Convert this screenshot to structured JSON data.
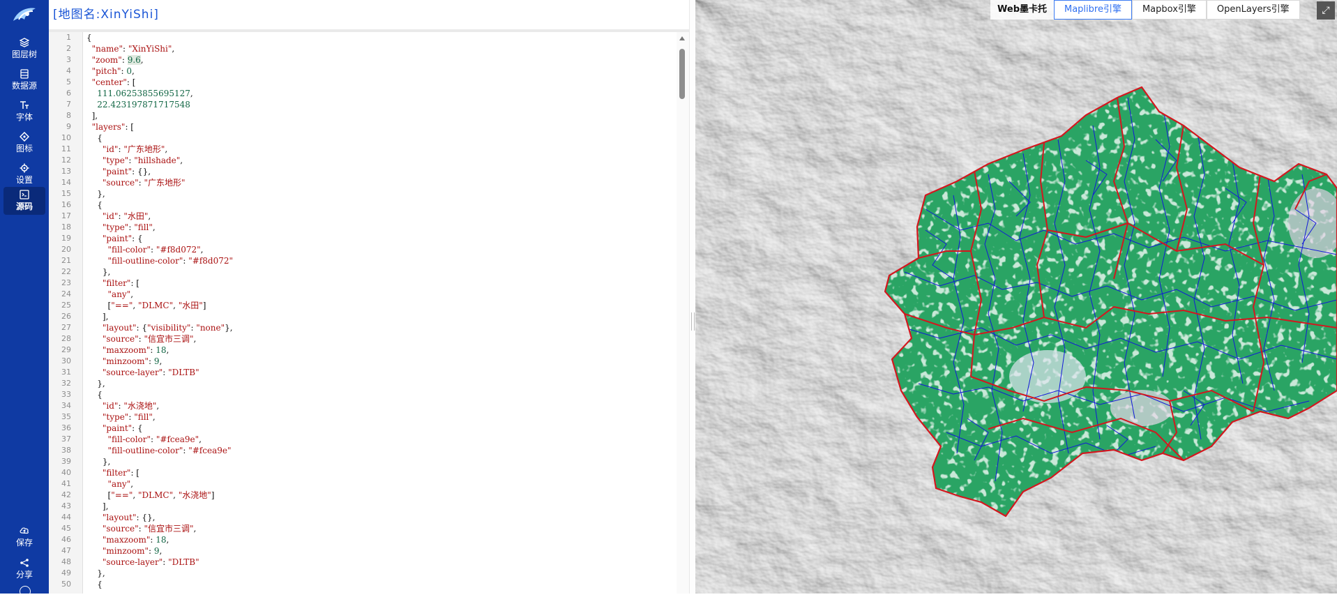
{
  "editor": {
    "title": "[地图名:XinYiShi]",
    "lines": [
      "{",
      "  \"name\": \"XinYiShi\",",
      "  \"zoom\": 9.6,",
      "  \"pitch\": 0,",
      "  \"center\": [",
      "    111.06253855695127,",
      "    22.423197871717548",
      "  ],",
      "  \"layers\": [",
      "    {",
      "      \"id\": \"广东地形\",",
      "      \"type\": \"hillshade\",",
      "      \"paint\": {},",
      "      \"source\": \"广东地形\"",
      "    },",
      "    {",
      "      \"id\": \"水田\",",
      "      \"type\": \"fill\",",
      "      \"paint\": {",
      "        \"fill-color\": \"#f8d072\",",
      "        \"fill-outline-color\": \"#f8d072\"",
      "      },",
      "      \"filter\": [",
      "        \"any\",",
      "        [\"==\", \"DLMC\", \"水田\"]",
      "      ],",
      "      \"layout\": {\"visibility\": \"none\"},",
      "      \"source\": \"信宜市三调\",",
      "      \"maxzoom\": 18,",
      "      \"minzoom\": 9,",
      "      \"source-layer\": \"DLTB\"",
      "    },",
      "    {",
      "      \"id\": \"水浇地\",",
      "      \"type\": \"fill\",",
      "      \"paint\": {",
      "        \"fill-color\": \"#fcea9e\",",
      "        \"fill-outline-color\": \"#fcea9e\"",
      "      },",
      "      \"filter\": [",
      "        \"any\",",
      "        [\"==\", \"DLMC\", \"水浇地\"]",
      "      ],",
      "      \"layout\": {},",
      "      \"source\": \"信宜市三调\",",
      "      \"maxzoom\": 18,",
      "      \"minzoom\": 9,",
      "      \"source-layer\": \"DLTB\"",
      "    },",
      "    {"
    ],
    "line_numbers": [
      "1",
      "2",
      "3",
      "4",
      "5",
      "6",
      "7",
      "8",
      "9",
      "10",
      "11",
      "12",
      "13",
      "14",
      "15",
      "16",
      "17",
      "18",
      "19",
      "20",
      "21",
      "22",
      "23",
      "24",
      "25",
      "26",
      "27",
      "28",
      "29",
      "30",
      "31",
      "32",
      "33",
      "34",
      "35",
      "36",
      "37",
      "38",
      "39",
      "40",
      "41",
      "42",
      "43",
      "44",
      "45",
      "46",
      "47",
      "48",
      "49",
      "50"
    ]
  },
  "sidebar": {
    "items": [
      {
        "label": "图层树",
        "icon": "layers-icon"
      },
      {
        "label": "数据源",
        "icon": "database-icon"
      },
      {
        "label": "字体",
        "icon": "font-icon"
      },
      {
        "label": "图标",
        "icon": "image-icon"
      },
      {
        "label": "设置",
        "icon": "gear-icon"
      },
      {
        "label": "源码",
        "icon": "code-icon",
        "active": true
      }
    ],
    "bottom": [
      {
        "label": "保存",
        "icon": "cloud-save-icon"
      },
      {
        "label": "分享",
        "icon": "share-icon"
      }
    ]
  },
  "toolbar": {
    "projection_label": "Web墨卡托",
    "engines": [
      "Maplibre引擎",
      "Mapbox引擎",
      "OpenLayers引擎"
    ],
    "active_engine": "Maplibre引擎"
  },
  "colors": {
    "sidebar_bg": "#0f3aa3",
    "title_blue": "#1a55d6",
    "region_fill": "#2aa464",
    "town_border": "#d3171e",
    "village_border": "#1219d8",
    "active_engine_border": "#3b7bf3"
  }
}
